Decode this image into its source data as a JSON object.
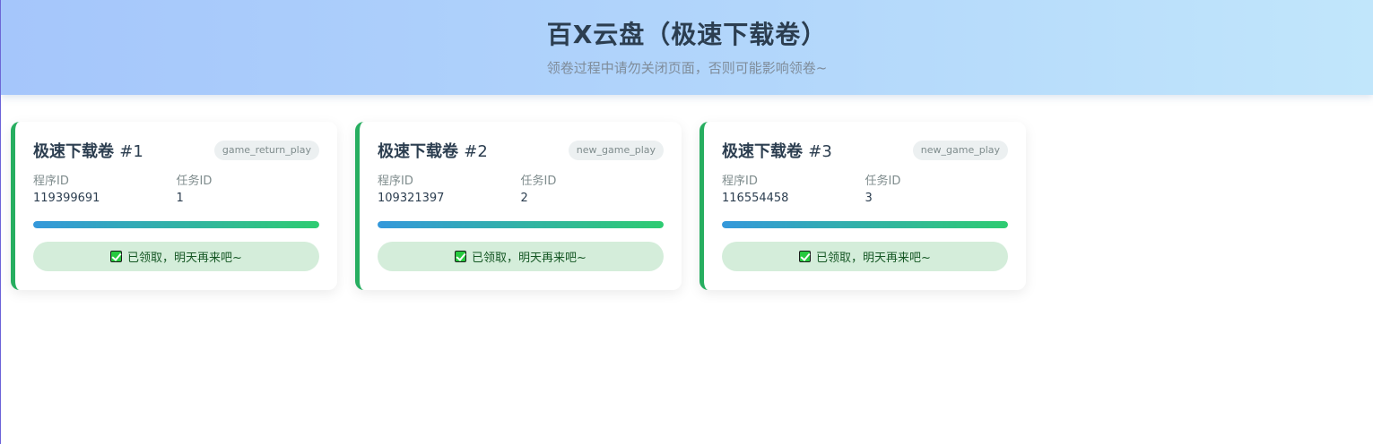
{
  "header": {
    "title": "百X云盘（极速下载卷）",
    "subtitle": "领卷过程中请勿关闭页面，否则可能影响领卷~"
  },
  "labels": {
    "program_id": "程序ID",
    "task_id": "任务ID"
  },
  "cards": [
    {
      "title": "极速下载卷",
      "number": "#1",
      "tag": "game_return_play",
      "program_id": "119399691",
      "task_id": "1",
      "progress": 1.0,
      "status": "已领取，明天再来吧~"
    },
    {
      "title": "极速下载卷",
      "number": "#2",
      "tag": "new_game_play",
      "program_id": "109321397",
      "task_id": "2",
      "progress": 1.0,
      "status": "已领取，明天再来吧~"
    },
    {
      "title": "极速下载卷",
      "number": "#3",
      "tag": "new_game_play",
      "program_id": "116554458",
      "task_id": "3",
      "progress": 1.0,
      "status": "已领取，明天再来吧~"
    }
  ],
  "colors": {
    "accent_border": "#27ae60",
    "progress_start": "#3498db",
    "progress_end": "#2ecc71",
    "status_bg": "#d4edda",
    "status_text": "#155724"
  },
  "icons": {
    "status": "check-box-icon"
  }
}
